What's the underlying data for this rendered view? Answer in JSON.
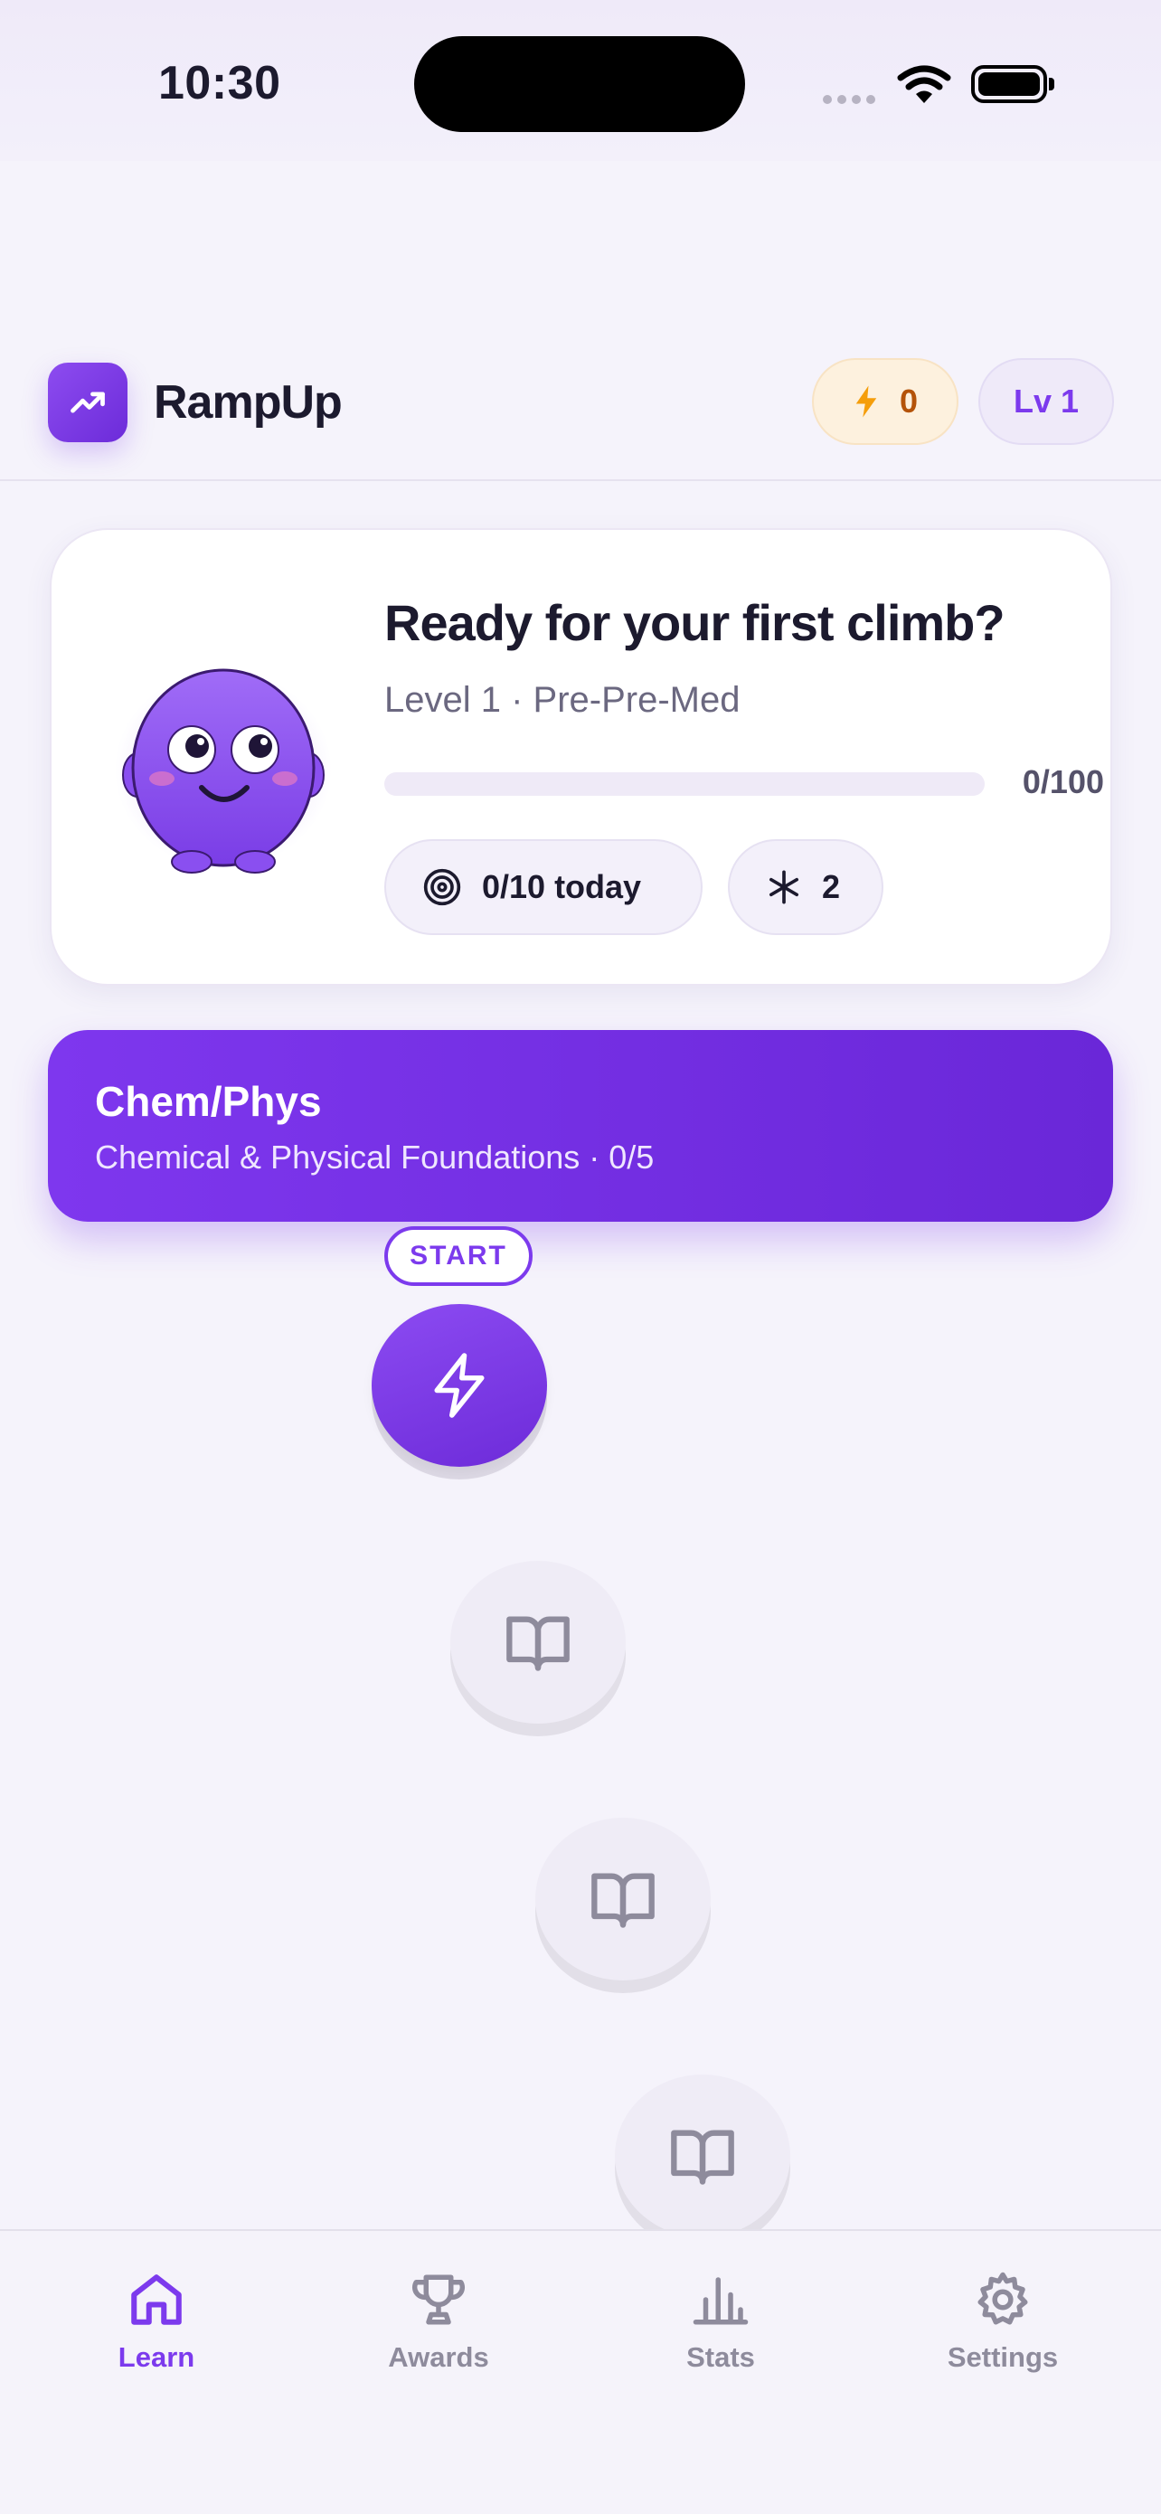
{
  "status_bar": {
    "time": "10:30"
  },
  "header": {
    "app_name": "RampUp",
    "xp_value": "0",
    "level_label": "Lv 1"
  },
  "hero_card": {
    "title": "Ready for your first climb?",
    "subtitle": "Level 1 · Pre-Pre-Med",
    "progress_label": "0/100",
    "progress_fraction": 0,
    "today_label": "0/10 today",
    "streak_value": "2"
  },
  "unit": {
    "title": "Chem/Phys",
    "subtitle": "Chemical & Physical Foundations · 0/5"
  },
  "path": {
    "start_label": "START",
    "nodes": [
      {
        "state": "active",
        "icon": "lightning-icon"
      },
      {
        "state": "locked",
        "icon": "book-icon"
      },
      {
        "state": "locked",
        "icon": "book-icon"
      },
      {
        "state": "locked",
        "icon": "book-icon"
      }
    ]
  },
  "tab_bar": {
    "tabs": [
      {
        "label": "Learn",
        "icon": "home-icon",
        "active": true
      },
      {
        "label": "Awards",
        "icon": "trophy-icon",
        "active": false
      },
      {
        "label": "Stats",
        "icon": "bar-chart-icon",
        "active": false
      },
      {
        "label": "Settings",
        "icon": "gear-icon",
        "active": false
      }
    ]
  },
  "colors": {
    "accent": "#7c3aed",
    "background": "#f5f3fb",
    "xp_bg": "#fdf1de",
    "xp_text": "#b45309",
    "inactive": "#8e8b9c"
  }
}
